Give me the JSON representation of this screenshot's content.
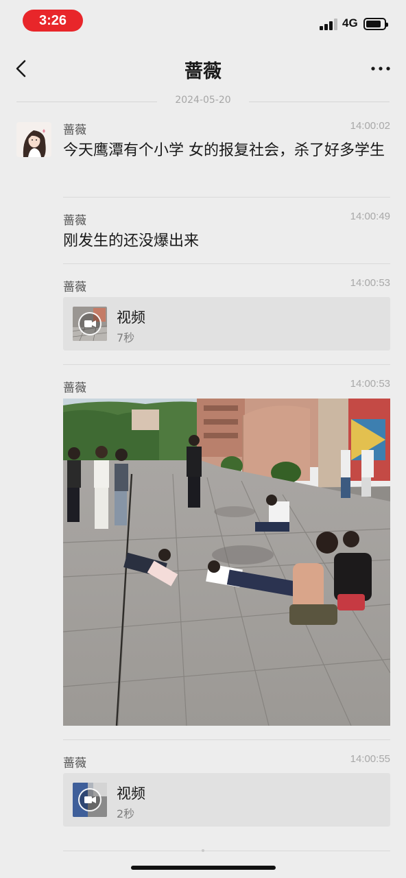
{
  "status_bar": {
    "time": "3:26",
    "network": "4G",
    "battery_level": 0.85,
    "signal_bars": 3
  },
  "nav": {
    "title": "蔷薇",
    "back_icon": "chevron-left-icon",
    "more_icon": "more-dots-icon"
  },
  "date_divider": "2024-05-20",
  "messages": [
    {
      "sender": "蔷薇",
      "time": "14:00:02",
      "text": "今天鹰潭有个小学  女的报复社会，杀了好多学生"
    },
    {
      "sender": "蔷薇",
      "time": "14:00:49",
      "text": "刚发生的还没爆出来"
    },
    {
      "sender": "蔷薇",
      "time": "14:00:53",
      "video": {
        "title": "视频",
        "duration": "7秒"
      }
    },
    {
      "sender": "蔷薇",
      "time": "14:00:53",
      "image": "photo"
    },
    {
      "sender": "蔷薇",
      "time": "14:00:55",
      "video": {
        "title": "视频",
        "duration": "2秒"
      }
    }
  ],
  "colors": {
    "background": "#ededed",
    "time_pill": "#e8262a",
    "separator": "#d9d9d9",
    "card": "#e1e1e1"
  }
}
